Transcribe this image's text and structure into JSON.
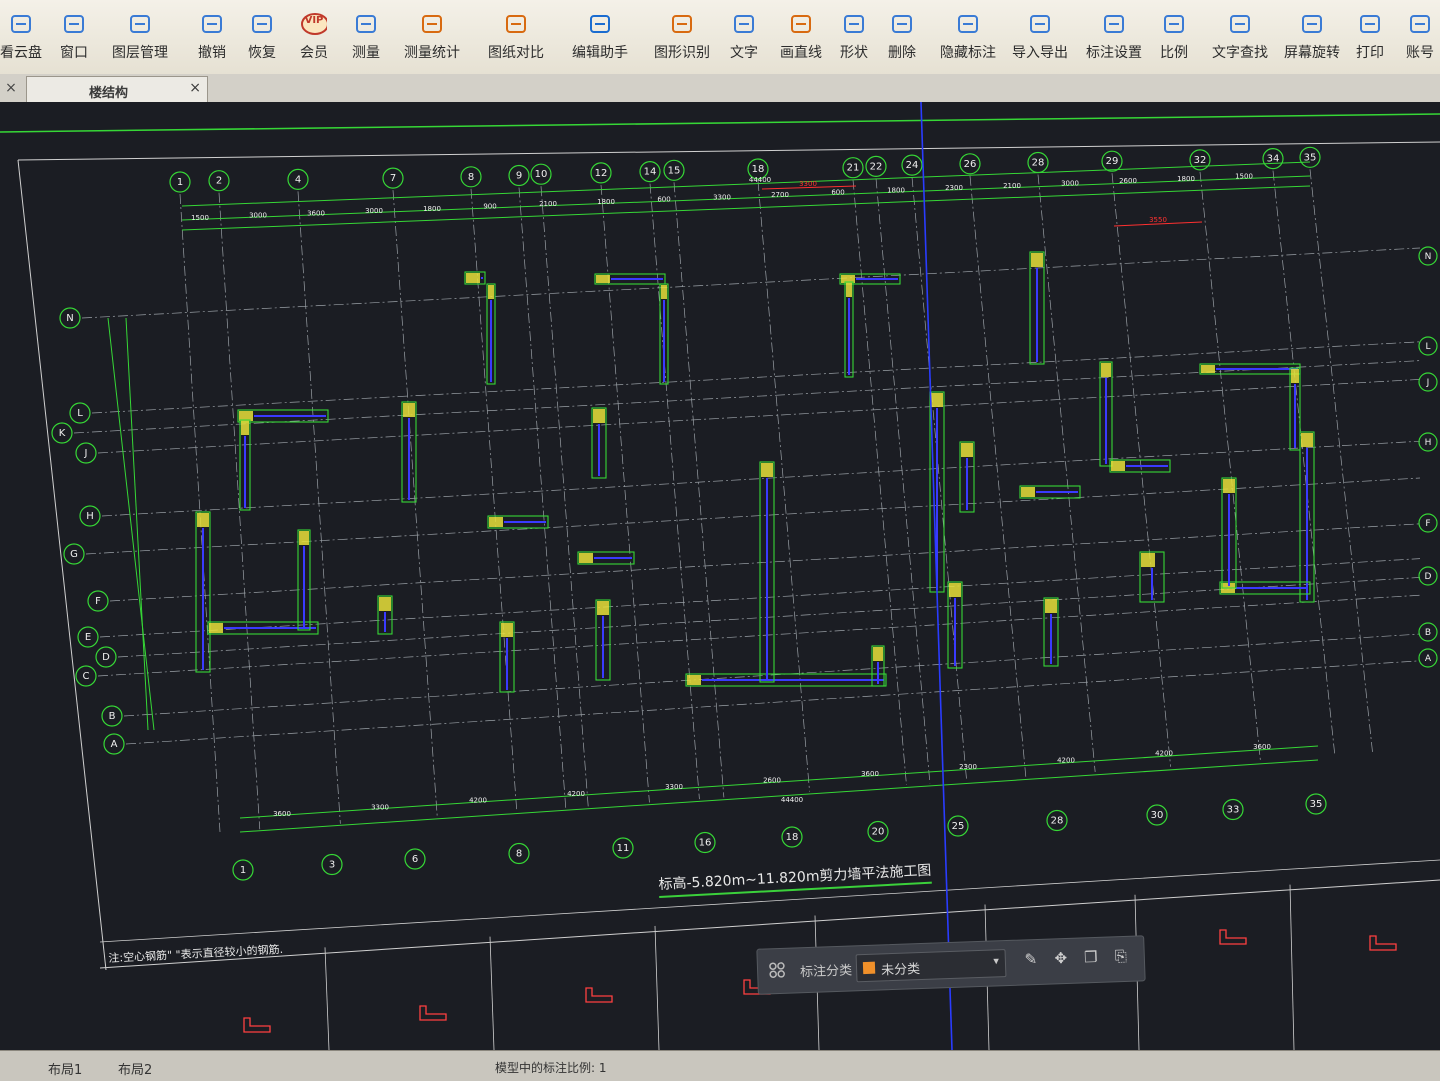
{
  "toolbar": {
    "items": [
      {
        "label": "看云盘",
        "icon": "cloud-icon"
      },
      {
        "label": "窗口",
        "icon": "window-icon"
      },
      {
        "label": "图层管理",
        "icon": "layers-icon"
      },
      {
        "label": "撤销",
        "icon": "undo-icon"
      },
      {
        "label": "恢复",
        "icon": "redo-icon"
      },
      {
        "label": "会员",
        "icon": "vip-icon"
      },
      {
        "label": "测量",
        "icon": "measure-icon"
      },
      {
        "label": "测量统计",
        "icon": "measure-stats-icon"
      },
      {
        "label": "图纸对比",
        "icon": "compare-icon"
      },
      {
        "label": "编辑助手",
        "icon": "edit-assistant-icon"
      },
      {
        "label": "图形识别",
        "icon": "shape-recognition-icon"
      },
      {
        "label": "文字",
        "icon": "text-icon"
      },
      {
        "label": "画直线",
        "icon": "line-icon"
      },
      {
        "label": "形状",
        "icon": "shape-icon"
      },
      {
        "label": "删除",
        "icon": "delete-icon"
      },
      {
        "label": "隐藏标注",
        "icon": "hide-annotation-icon"
      },
      {
        "label": "导入导出",
        "icon": "import-export-icon"
      },
      {
        "label": "标注设置",
        "icon": "annotation-settings-icon"
      },
      {
        "label": "比例",
        "icon": "scale-icon"
      },
      {
        "label": "文字查找",
        "icon": "text-search-icon"
      },
      {
        "label": "屏幕旋转",
        "icon": "rotate-screen-icon"
      },
      {
        "label": "打印",
        "icon": "print-icon"
      },
      {
        "label": "账号",
        "icon": "account-icon"
      }
    ],
    "vip_badge": "VIP"
  },
  "tabs": {
    "close_left": "×",
    "active_tab": "楼结构",
    "active_close": "×"
  },
  "drawing": {
    "title": "标高-5.820m~11.820m剪力墙平法施工图",
    "note": "注:空心钢筋\" \"表示直径较小的钢筋.",
    "top_axes": [
      "1",
      "2",
      "4",
      "7",
      "8",
      "9",
      "10",
      "12",
      "14",
      "15",
      "18",
      "21",
      "22",
      "24",
      "26",
      "28",
      "29",
      "32",
      "34",
      "35"
    ],
    "bottom_axes": [
      "1",
      "3",
      "6",
      "8",
      "11",
      "16",
      "18",
      "20",
      "25",
      "28",
      "30",
      "33",
      "35"
    ],
    "left_axes": [
      "N",
      "L",
      "K",
      "J",
      "H",
      "G",
      "F",
      "E",
      "D",
      "C",
      "B",
      "A"
    ],
    "right_axes": [
      "N",
      "L",
      "J",
      "H",
      "F",
      "D",
      "B",
      "A"
    ],
    "top_dims": [
      "1500",
      "3000",
      "3600",
      "3000",
      "1800",
      "900",
      "2100",
      "1800",
      "600",
      "3300",
      "2700",
      "600",
      "1800",
      "2300",
      "2100",
      "3000",
      "2600",
      "1800",
      "1500"
    ],
    "top_total": "44400",
    "top_red_dim": "3300",
    "right_red_dim": "3550",
    "bottom_dims": [
      "3600",
      "3300",
      "4200",
      "4200",
      "3300",
      "2600",
      "3600",
      "2300",
      "4200",
      "4200",
      "3600"
    ],
    "bottom_total": "44400"
  },
  "float_toolbar": {
    "label": "标注分类",
    "selected": "未分类",
    "swatch_color": "#f0902a",
    "dropdown_icon": "▾"
  },
  "statusbar": {
    "layout_tabs": [
      "布局1",
      "布局2"
    ],
    "status": "模型中的标注比例: 1"
  },
  "colors": {
    "axis_green": "#36d736",
    "wall_yellow": "#e8e03a",
    "rebar_blue": "#3a3aff",
    "dim_red": "#ff3030",
    "background": "#1b1d23"
  }
}
